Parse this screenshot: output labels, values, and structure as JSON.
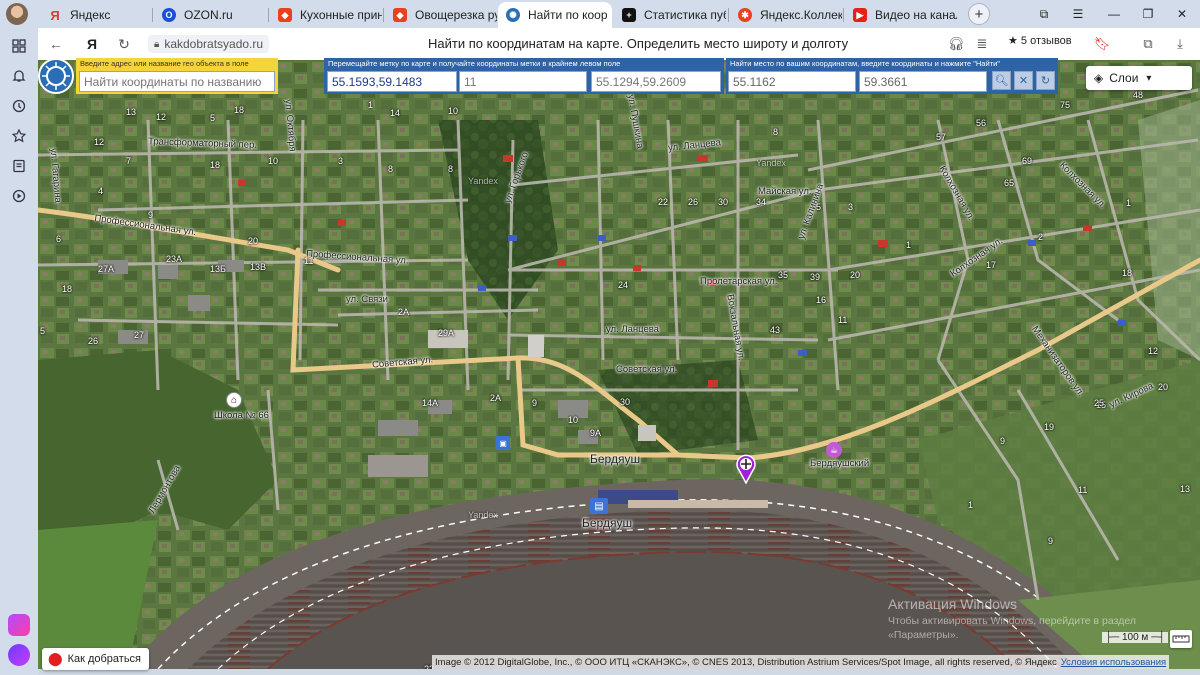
{
  "tabs": [
    {
      "title": "Яндекс",
      "icon": "yandex-icon",
      "color": "#e03a2f"
    },
    {
      "title": "OZON.ru",
      "icon": "ozon-icon",
      "color": "#1a4fd6"
    },
    {
      "title": "Кухонные прина",
      "icon": "zen-icon",
      "color": "#e8411c"
    },
    {
      "title": "Овощерезка руч",
      "icon": "zen-icon",
      "color": "#e8411c"
    },
    {
      "title": "Найти по коор",
      "icon": "site-icon",
      "color": "#2a6fb6",
      "active": true,
      "close": "✕"
    },
    {
      "title": "Статистика публ",
      "icon": "plus-icon",
      "color": "#111111"
    },
    {
      "title": "Яндекс.Коллекци",
      "icon": "collections-icon",
      "color": "#e8411c"
    },
    {
      "title": "Видео на канале",
      "icon": "youtube-icon",
      "color": "#e62117"
    }
  ],
  "address_bar": {
    "logo": "Я",
    "url": "kakdobratsyado.ru",
    "page_title": "Найти по координатам на карте. Определить место широту и долготу",
    "reviews": "★ 5 отзывов"
  },
  "toolbar": {
    "search": {
      "label": "Введите адрес или название гео объекта в поле",
      "placeholder": "Найти координаты по названию"
    },
    "marker": {
      "label": "Перемещайте метку по карте и получайте координаты метки в крайнем левом поле",
      "coords": "55.1593,59.1483",
      "zoom": "11",
      "center": "55.1294,59.2609"
    },
    "find": {
      "label": "Найти место по вашим координатам, введите координаты и нажмите \"Найти\"",
      "lat": "55.1162",
      "lon": "59.3661"
    }
  },
  "map": {
    "layers": "Слои",
    "how_to_get": "Как добраться",
    "scale": "100 м",
    "copyright": "Image © 2012 DigitalGlobe, Inc., © ООО ИТЦ «СКАНЭКС», © CNES 2013, Distribution Astrium Services/Spot Image, all rights reserved, © Яндекс",
    "terms": "Условия использования",
    "watermark_title": "Активация Windows",
    "watermark_text": "Чтобы активировать Windows, перейдите в раздел «Параметры».",
    "labels": {
      "station": "Бердяуш",
      "station2": "Бердяуш",
      "cafe": "Бердяушский",
      "school": "Школа № 66",
      "yandex1": "Yandex",
      "yandex2": "Yandex",
      "yandex3": "Yandex"
    },
    "streets": {
      "professional1": "Профессиональная ул.",
      "professional2": "Профессиональная ул.",
      "sovetskaya1": "Советская ул.",
      "sovetskaya2": "Советская ул.",
      "transformatorny": "Трансформаторный пер.",
      "svyazi": "ул. Связи",
      "lantseva1": "ул. Ланцева",
      "lantseva2": "ул. Ланцева",
      "proletarskaya": "Пролетарская ул.",
      "mayskaya": "Майская ул.",
      "kolkhoznaya1": "Колхозная ул.",
      "kolkhoznaya2": "Колхозная ул.",
      "kolkhoznaya3": "Колхозная ул.",
      "vokzalnaya": "Вокзальная ул.",
      "kalinina": "ул. Калинина",
      "kirova": "ул. Кирова",
      "mekhanizatorov": "Механизаторов ул.",
      "gagarina": "ул. Гагарина",
      "oktyabrya": "ул. Октября",
      "lermontova": "Лермонтова",
      "gorkogo": "ул. Горького",
      "pushkina": "ул. Пушкина"
    },
    "house_numbers": [
      "13",
      "12",
      "18",
      "5",
      "1",
      "14",
      "10",
      "12",
      "7",
      "18",
      "10",
      "3",
      "8",
      "8",
      "9",
      "4",
      "6",
      "20",
      "11",
      "27А",
      "13Б",
      "23А",
      "13В",
      "18",
      "5",
      "26",
      "27",
      "2А",
      "29А",
      "14А",
      "2А",
      "9А",
      "30",
      "9",
      "10",
      "22",
      "26",
      "30",
      "34",
      "24",
      "35",
      "39",
      "43",
      "20",
      "16",
      "11",
      "1",
      "17",
      "8",
      "5",
      "3",
      "2",
      "56",
      "57",
      "75",
      "69",
      "65",
      "48",
      "1",
      "18",
      "12",
      "20",
      "19",
      "15",
      "11",
      "9",
      "25",
      "13",
      "9",
      "1",
      "22"
    ]
  }
}
